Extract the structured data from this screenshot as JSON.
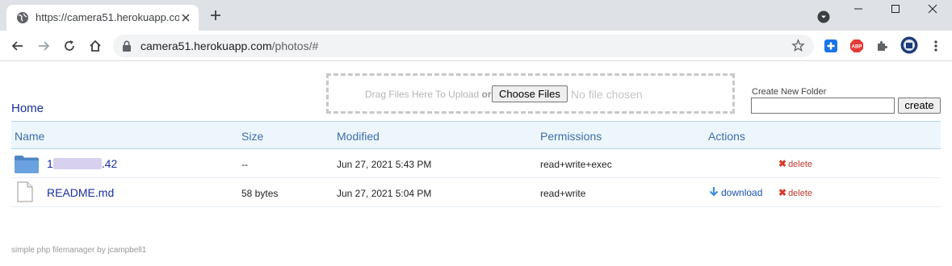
{
  "browser": {
    "tab_title": "https://camera51.herokuapp.com",
    "url_host": "camera51.herokuapp.com",
    "url_path": "/photos/#"
  },
  "upload": {
    "drag_text": "Drag Files Here To Upload",
    "or_text": "or",
    "choose_label": "Choose Files",
    "no_file_text": "No file chosen"
  },
  "new_folder": {
    "label": "Create New Folder",
    "value": "",
    "create_label": "create"
  },
  "breadcrumb": {
    "home": "Home"
  },
  "table": {
    "headers": {
      "name": "Name",
      "size": "Size",
      "modified": "Modified",
      "permissions": "Permissions",
      "actions": "Actions"
    },
    "rows": [
      {
        "type": "folder",
        "name_prefix": "1",
        "name_suffix": ".42",
        "size": "--",
        "modified": "Jun 27, 2021 5:43 PM",
        "permissions": "read+write+exec",
        "download": "",
        "delete": "delete"
      },
      {
        "type": "file",
        "name": "README.md",
        "size": "58 bytes",
        "modified": "Jun 27, 2021 5:04 PM",
        "permissions": "read+write",
        "download": "download",
        "delete": "delete"
      }
    ]
  },
  "footer": "simple php filemanager by jcampbell1",
  "colors": {
    "link": "#1a2fa0",
    "header_bg": "#edf6fd",
    "delete": "#c0392b"
  }
}
